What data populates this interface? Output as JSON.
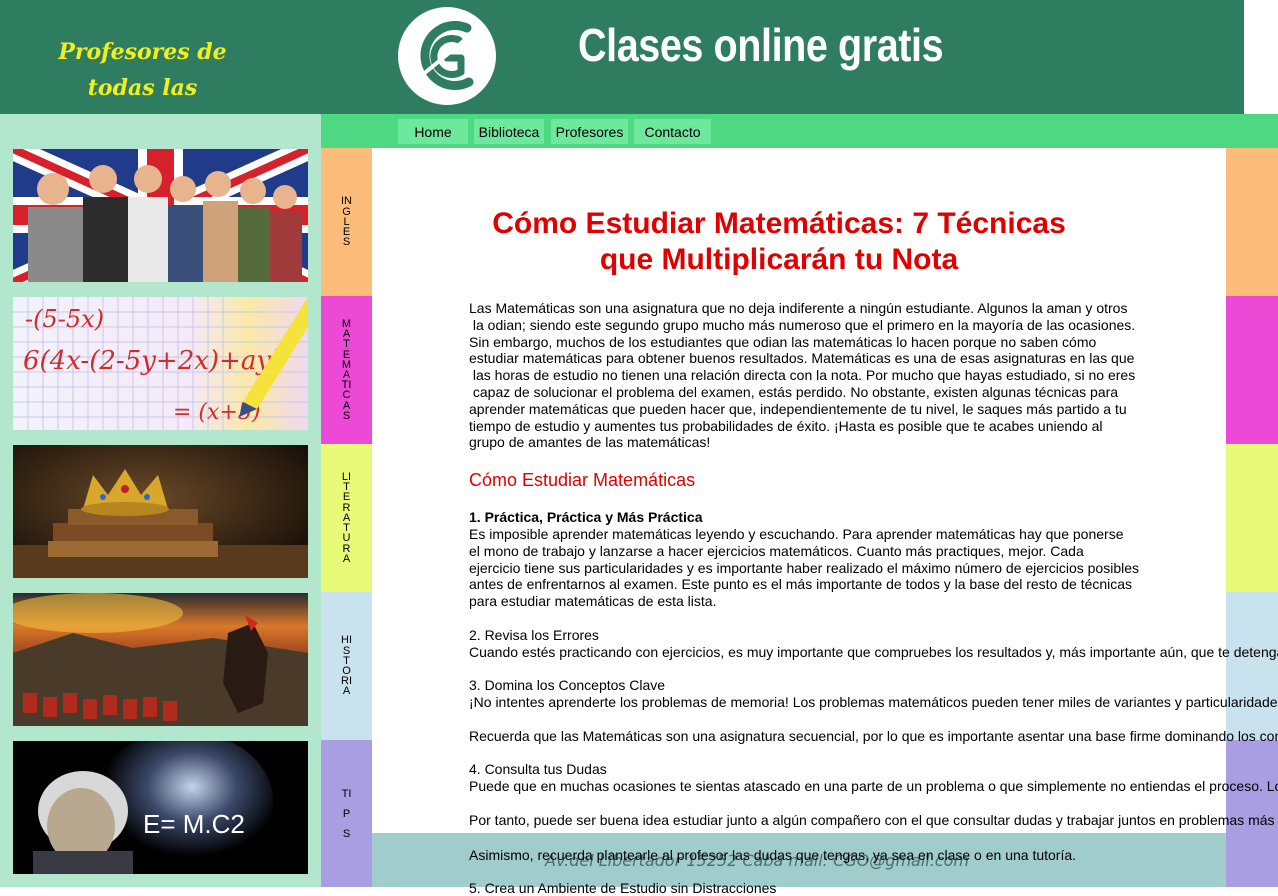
{
  "header": {
    "tagline_line1": "Profesores de",
    "tagline_line2": "todas las materias!",
    "site_title": "Clases online gratis",
    "logo_icon": "cg-logo-icon"
  },
  "nav": {
    "items": [
      {
        "label": "Home"
      },
      {
        "label": "Biblioteca"
      },
      {
        "label": "Profesores"
      },
      {
        "label": "Contacto"
      }
    ]
  },
  "sidebar": {
    "thumbs": [
      {
        "icon": "students-uk-flag-photo"
      },
      {
        "icon": "math-formula-photo"
      },
      {
        "icon": "crown-books-photo"
      },
      {
        "icon": "roman-battle-photo"
      },
      {
        "icon": "einstein-photo",
        "caption": "E= M.C2"
      }
    ]
  },
  "subjects": {
    "items": [
      {
        "label": "INGLES",
        "color": "#fdbd7a"
      },
      {
        "label": "MATEMATICAS",
        "color": "#ec4ad6"
      },
      {
        "label": "LITERATURA",
        "color": "#e8fb78"
      },
      {
        "label": "HISTORIA",
        "color": "#c8e2ee"
      },
      {
        "label": "TIPS",
        "color": "#a99ee1"
      }
    ]
  },
  "article": {
    "title_line1": "Cómo Estudiar Matemáticas: 7 Técnicas",
    "title_line2": "que Multiplicarán tu Nota",
    "intro_lines": [
      "Las Matemáticas son una asignatura que no deja indiferente a ningún estudiante. Algunos la aman y otros",
      " la odian; siendo este segundo grupo mucho más numeroso que el primero en la mayoría de las ocasiones.",
      "Sin embargo, muchos de los estudiantes que odian las matemáticas lo hacen porque no saben cómo",
      "estudiar matemáticas para obtener buenos resultados. Matemáticas es una de esas asignaturas en las que",
      " las horas de estudio no tienen una relación directa con la nota. Por mucho que hayas estudiado, si no eres",
      " capaz de solucionar el problema del examen, estás perdido. No obstante, existen algunas técnicas para",
      "aprender matemáticas que pueden hacer que, independientemente de tu nivel, le saques más partido a tu",
      "tiempo de estudio y aumentes tus probabilidades de éxito. ¡Hasta es posible que te acabes uniendo al",
      "grupo de amantes de las matemáticas!"
    ],
    "section_heading": "Cómo Estudiar Matemáticas",
    "tip1_title": "1. Práctica, Práctica y Más Práctica",
    "tip1_lines": [
      "Es imposible aprender matemáticas leyendo y escuchando. Para aprender matemáticas hay que ponerse",
      "el mono de trabajo y lanzarse a hacer ejercicios matemáticos. Cuanto más practiques, mejor. Cada",
      "ejercicio tiene sus particularidades y es importante haber realizado el máximo número de ejercicios posibles",
      "antes de enfrentarnos al examen. Este punto es el más importante de todos y la base del resto de técnicas",
      "para estudiar matemáticas de esta lista."
    ],
    "tip2_title": "2. Revisa los Errores",
    "tip2_text": "Cuando estés practicando con ejercicios, es muy importante que compruebes los resultados y, más importante aún, que te detengas",
    "tip3_title": "3. Domina los Conceptos Clave",
    "tip3_text": "¡No intentes aprenderte los problemas de memoria! Los problemas matemáticos pueden tener miles de variantes y particularidades",
    "tip3_text2": "Recuerda que las Matemáticas son una asignatura secuencial, por lo que es importante asentar una base firme dominando los conceptos",
    "tip4_title": "4. Consulta tus Dudas",
    "tip4_text": "Puede que en muchas ocasiones te sientas atascado en una parte de un problema o que simplemente no entiendas el proceso. Lo",
    "tip4_text2": "Por tanto, puede ser buena idea estudiar junto a algún compañero con el que consultar dudas y trabajar juntos en problemas más",
    "tip4_text3": "Asimismo, recuerda plantearle al profesor las dudas que tengas, ya sea en clase o en una tutoría.",
    "tip5_title": "5. Crea un Ambiente de Estudio sin Distracciones"
  },
  "footer": {
    "text": "Av.del Libertador 15252 Caba mail: CGO@gmail.com"
  }
}
